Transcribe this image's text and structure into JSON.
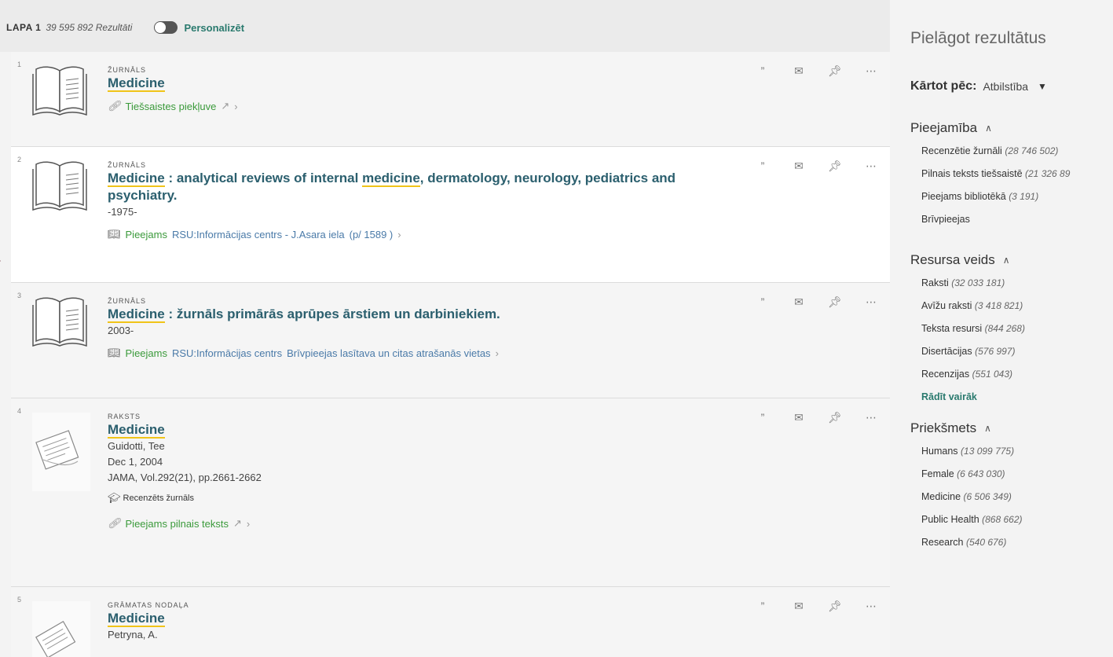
{
  "topbar": {
    "page_label": "LAPA 1",
    "result_count": "39 595 892 Rezultāti",
    "personalize_label": "Personalizēt"
  },
  "results": [
    {
      "num": "1",
      "type": "ŽURNĀLS",
      "title_highlight": "Medicine",
      "title_rest": "",
      "meta": [],
      "link_icon": "link-icon",
      "link_text": "Tiešsaistes piekļuve",
      "link_extra": "",
      "link_extra2": ""
    },
    {
      "num": "2",
      "type": "ŽURNĀLS",
      "title_highlight": "Medicine",
      "title_rest_1": " : analytical reviews of internal ",
      "title_highlight_2": "medicine",
      "title_rest_2": ", dermatology, neurology, pediatrics and psychiatry.",
      "meta": [
        "-1975-"
      ],
      "link_icon": "book-icon",
      "link_text": "Pieejams",
      "link_extra": "RSU:Informācijas centrs - J.Asara iela",
      "link_extra2": "(p/ 1589 )"
    },
    {
      "num": "3",
      "type": "ŽURNĀLS",
      "title_highlight": "Medicine",
      "title_rest": " : žurnāls primārās aprūpes ārstiem un darbiniekiem.",
      "meta": [
        "2003-"
      ],
      "link_icon": "book-icon",
      "link_text": "Pieejams",
      "link_extra": "RSU:Informācijas centrs",
      "link_extra2": "Brīvpieejas lasītava un citas atrašanās vietas"
    },
    {
      "num": "4",
      "type": "RAKSTS",
      "title_highlight": "Medicine",
      "title_rest": "",
      "meta": [
        "Guidotti, Tee",
        "Dec 1, 2004",
        "JAMA, Vol.292(21), pp.2661-2662"
      ],
      "peer_review": "Recenzēts žurnāls",
      "link_icon": "link-icon",
      "link_text": "Pieejams pilnais teksts",
      "link_extra": "",
      "link_extra2": ""
    },
    {
      "num": "5",
      "type": "GRĀMATAS NODAĻA",
      "title_highlight": "Medicine",
      "title_rest": "",
      "meta": [
        "Petryna, A."
      ]
    }
  ],
  "sidebar": {
    "title": "Pielāgot rezultātus",
    "sort_label": "Kārtot pēc:",
    "sort_value": "Atbilstība",
    "facets": [
      {
        "heading": "Pieejamība",
        "items": [
          {
            "label": "Recenzētie žurnāli",
            "count": "(28 746 502)"
          },
          {
            "label": "Pilnais teksts tiešsaistē",
            "count": "(21 326 89"
          },
          {
            "label": "Pieejams bibliotēkā",
            "count": "(3 191)"
          },
          {
            "label": "Brīvpieejas",
            "count": ""
          }
        ]
      },
      {
        "heading": "Resursa veids",
        "items": [
          {
            "label": "Raksti",
            "count": "(32 033 181)"
          },
          {
            "label": "Avīžu raksti",
            "count": "(3 418 821)"
          },
          {
            "label": "Teksta resursi",
            "count": "(844 268)"
          },
          {
            "label": "Disertācijas",
            "count": "(576 997)"
          },
          {
            "label": "Recenzijas",
            "count": "(551 043)"
          }
        ],
        "show_more": "Rādīt vairāk"
      },
      {
        "heading": "Priekšmets",
        "items": [
          {
            "label": "Humans",
            "count": "(13 099 775)"
          },
          {
            "label": "Female",
            "count": "(6 643 030)"
          },
          {
            "label": "Medicine",
            "count": "(6 506 349)"
          },
          {
            "label": "Public Health",
            "count": "(868 662)"
          },
          {
            "label": "Research",
            "count": "(540 676)"
          }
        ]
      }
    ]
  },
  "colors": {
    "accent": "#2a7a6e",
    "title": "#2b5f6e",
    "highlight": "#f0c419",
    "link_green": "#3b9a3b",
    "marker": "#8b1a2b"
  }
}
